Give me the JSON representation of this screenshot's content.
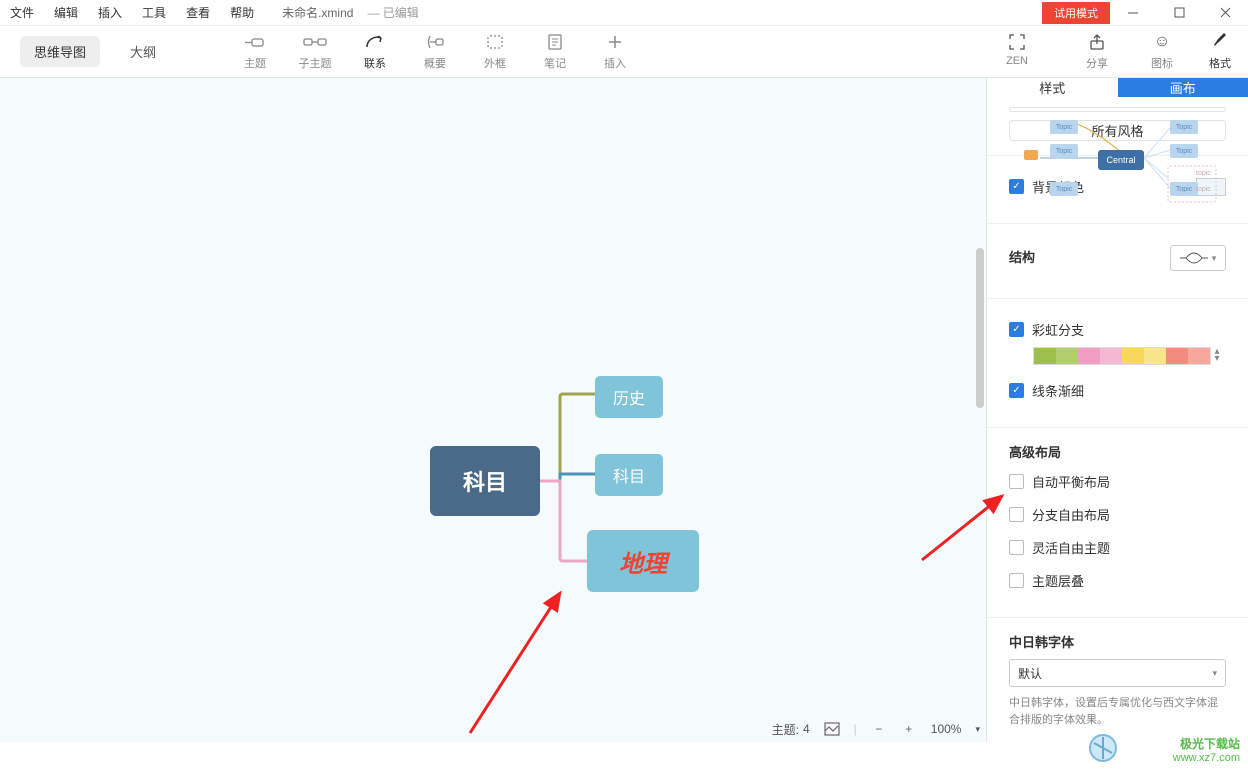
{
  "menu": {
    "file": "文件",
    "edit": "编辑",
    "insert": "插入",
    "tools": "工具",
    "view": "查看",
    "help": "帮助"
  },
  "doc": {
    "name": "未命名.xmind",
    "state": "— 已编辑"
  },
  "trial": "试用模式",
  "view_tabs": {
    "mindmap": "思维导图",
    "outline": "大纲"
  },
  "toolbar": {
    "topic": "主题",
    "subtopic": "子主题",
    "relation": "联系",
    "summary": "概要",
    "boundary": "外框",
    "note": "笔记",
    "insert": "插入",
    "zen": "ZEN",
    "share": "分享",
    "icons": "图标",
    "format": "格式"
  },
  "mindmap": {
    "central": "科目",
    "n1": "历史",
    "n2": "科目",
    "n3": "地理"
  },
  "panel": {
    "tab_style": "样式",
    "tab_canvas": "画布",
    "preview_central": "Central",
    "preview_topic": "Topic",
    "preview_topic2": "topic",
    "all_styles": "所有风格",
    "bg_color": "背景颜色",
    "structure": "结构",
    "rainbow": "彩虹分支",
    "taper": "线条渐细",
    "adv_layout": "高级布局",
    "auto_balance": "自动平衡布局",
    "branch_free": "分支自由布局",
    "flex_topic": "灵活自由主题",
    "overlap": "主题层叠",
    "cjk_font": "中日韩字体",
    "font_default": "默认",
    "hint": "中日韩字体，设置后专属优化与西文字体混合排版的字体效果。"
  },
  "status": {
    "topics_label": "主题:",
    "topics_count": "4",
    "zoom": "100%"
  },
  "watermark": {
    "t1": "极光下载站",
    "t2": "www.xz7.com"
  }
}
